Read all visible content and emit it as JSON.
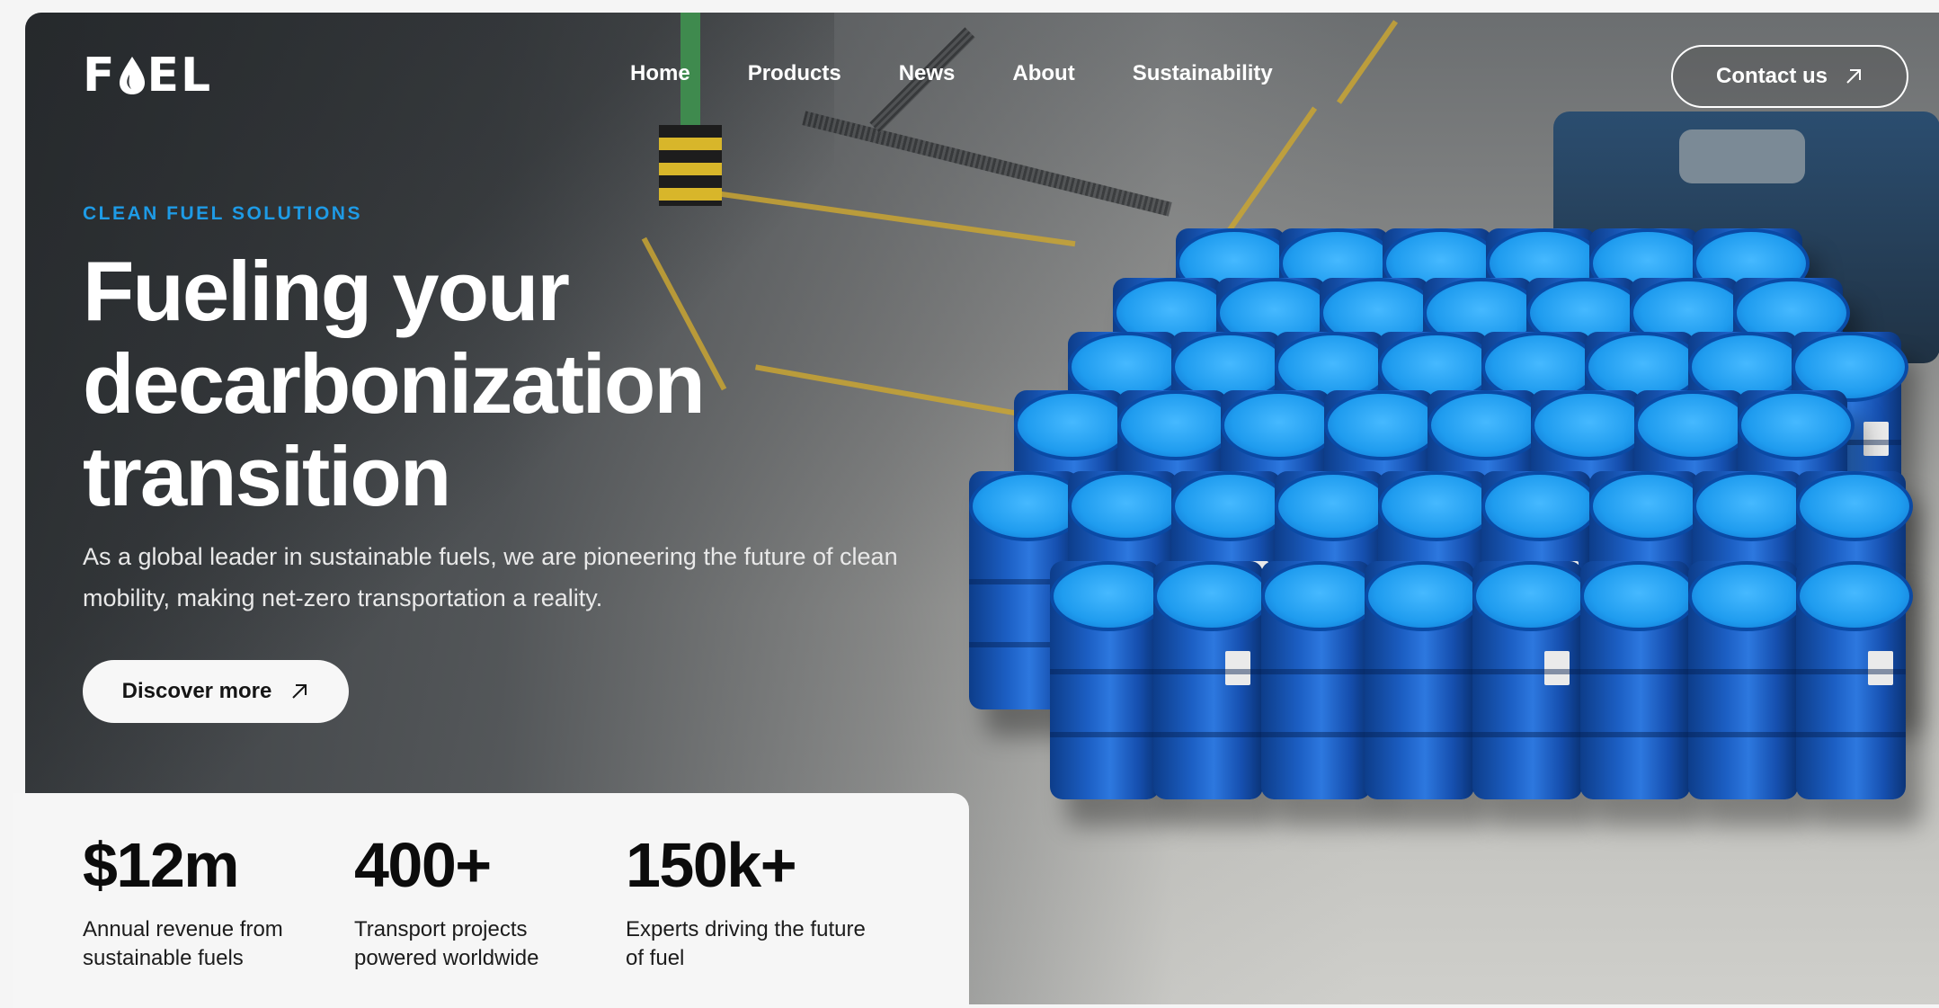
{
  "brand": {
    "logo_text_left": "F",
    "logo_text_right": "EL"
  },
  "nav": {
    "items": [
      "Home",
      "Products",
      "News",
      "About",
      "Sustainability"
    ],
    "contact_label": "Contact us"
  },
  "hero": {
    "eyebrow": "CLEAN FUEL SOLUTIONS",
    "headline_line1": "Fueling your",
    "headline_line2": "decarbonization",
    "headline_line3": "transition",
    "subtext_line1": "As a global leader in sustainable fuels, we are pioneering the future of clean",
    "subtext_line2": "mobility, making net-zero transportation a reality.",
    "cta_label": "Discover more"
  },
  "stats": [
    {
      "value": "$12m",
      "desc_line1": "Annual revenue from",
      "desc_line2": "sustainable fuels"
    },
    {
      "value": "400+",
      "desc_line1": "Transport projects",
      "desc_line2": "powered worldwide"
    },
    {
      "value": "150k+",
      "desc_line1": "Experts driving the future",
      "desc_line2": "of fuel"
    }
  ],
  "colors": {
    "accent": "#1e9be6",
    "text_light": "#ffffff",
    "panel_bg": "#f6f6f6",
    "barrel_blue": "#1c5fc4"
  },
  "icons": {
    "contact_arrow": "arrow-up-right-icon",
    "cta_arrow": "arrow-up-right-icon",
    "logo_drop": "flame-drop-icon"
  }
}
